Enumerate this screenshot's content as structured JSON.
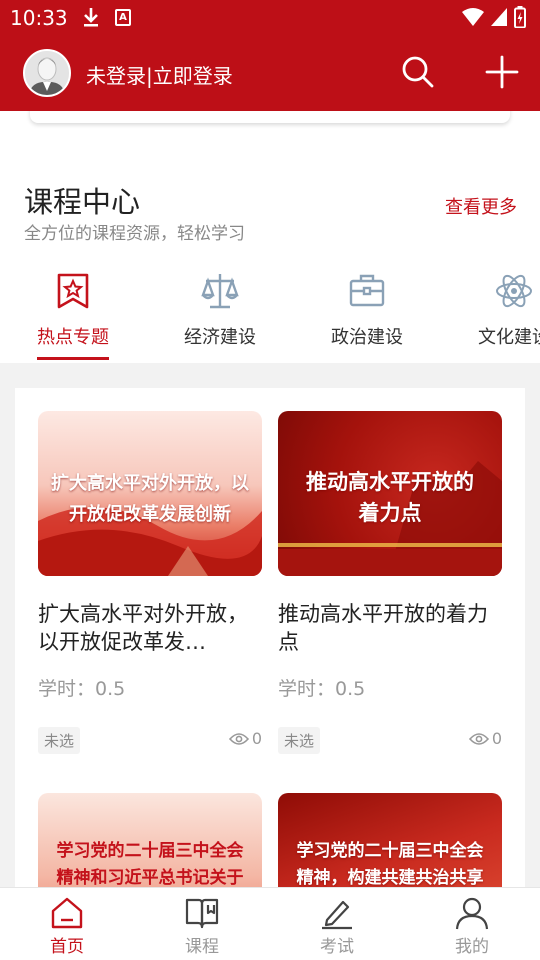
{
  "status_bar": {
    "time": "10:33"
  },
  "header": {
    "login_text": "未登录|立即登录"
  },
  "course_center": {
    "title": "课程中心",
    "subtitle": "全方位的课程资源，轻松学习",
    "more": "查看更多"
  },
  "tabs": [
    {
      "label": "热点专题",
      "icon": "bookmark-star-icon",
      "active": true
    },
    {
      "label": "经济建设",
      "icon": "scale-icon",
      "active": false
    },
    {
      "label": "政治建设",
      "icon": "briefcase-icon",
      "active": false
    },
    {
      "label": "文化建设",
      "icon": "atom-icon",
      "active": false
    }
  ],
  "cards": [
    {
      "thumb_line1": "扩大高水平对外开放，以",
      "thumb_line2": "开放促改革发展创新",
      "title": "扩大高水平对外开放，以开放促改革发…",
      "hours": "学时：0.5",
      "badge": "未选",
      "views": "0"
    },
    {
      "thumb_line1": "推动高水平开放的",
      "thumb_line2": "着力点",
      "title": "推动高水平开放的着力点",
      "hours": "学时：0.5",
      "badge": "未选",
      "views": "0"
    },
    {
      "thumb_line1": "学习党的二十届三中全会",
      "thumb_line2": "精神和习近平总书记关于"
    },
    {
      "thumb_line1": "学习党的二十届三中全会",
      "thumb_line2": "精神，构建共建共治共享"
    }
  ],
  "nav": [
    {
      "label": "首页",
      "icon": "home-icon",
      "active": true
    },
    {
      "label": "课程",
      "icon": "book-icon",
      "active": false
    },
    {
      "label": "考试",
      "icon": "pen-icon",
      "active": false
    },
    {
      "label": "我的",
      "icon": "user-icon",
      "active": false
    }
  ],
  "colors": {
    "brand_red": "#bd0f17",
    "accent_red": "#c4121b"
  }
}
